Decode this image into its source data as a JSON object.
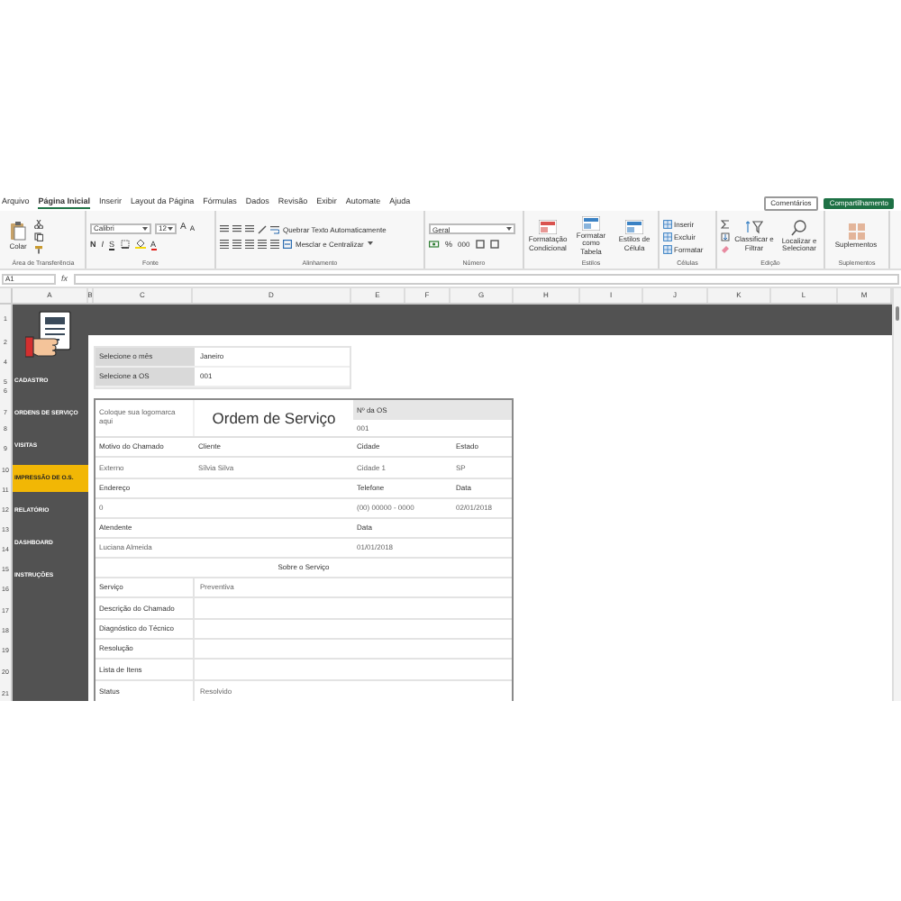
{
  "menu_tabs": [
    {
      "label": "Arquivo",
      "selected": false
    },
    {
      "label": "Página Inicial",
      "selected": true
    },
    {
      "label": "Inserir",
      "selected": false
    },
    {
      "label": "Layout da Página",
      "selected": false
    },
    {
      "label": "Fórmulas",
      "selected": false
    },
    {
      "label": "Dados",
      "selected": false
    },
    {
      "label": "Revisão",
      "selected": false
    },
    {
      "label": "Exibir",
      "selected": false
    },
    {
      "label": "Automate",
      "selected": false
    },
    {
      "label": "Ajuda",
      "selected": false
    }
  ],
  "header_buttons": [
    {
      "label": "Comentários",
      "kind": "outline"
    },
    {
      "label": "Compartilhamento",
      "kind": "primary"
    }
  ],
  "ribbon_groups": [
    {
      "kind": "clipboard",
      "title": "Área de Transferência",
      "paste_label": "Colar"
    },
    {
      "kind": "font",
      "title": "Fonte",
      "font_name": "Calibri",
      "font_size": "12",
      "bold": "N",
      "italic": "I",
      "underline": "S",
      "grow": "A",
      "shrink": "A",
      "font_color": "A"
    },
    {
      "kind": "alignment",
      "title": "Alinhamento",
      "wrap_label": "Quebrar Texto Automaticamente",
      "merge_label": "Mesclar e Centralizar"
    },
    {
      "kind": "number",
      "title": "Número",
      "format": "Geral",
      "percent": "%",
      "thousands": "000"
    },
    {
      "kind": "styles",
      "title": "Estilos",
      "buttons": [
        "Formatação Condicional",
        "Formatar como Tabela",
        "Estilos de Célula"
      ]
    },
    {
      "kind": "cells",
      "title": "Células",
      "buttons": [
        "Inserir",
        "Excluir",
        "Formatar"
      ]
    },
    {
      "kind": "editing",
      "title": "Edição",
      "buttons": [
        "Classificar e Filtrar",
        "Localizar e Selecionar"
      ]
    },
    {
      "kind": "addins",
      "title": "Suplementos",
      "buttons": [
        "Suplementos"
      ]
    }
  ],
  "formula_bar": {
    "cell_ref": "A1",
    "fx": "fx"
  },
  "column_headers": [
    "A",
    "B",
    "C",
    "D",
    "E",
    "F",
    "G",
    "H",
    "I",
    "J",
    "K",
    "L",
    "M"
  ],
  "row_numbers": [
    "1",
    "2",
    "4",
    "5",
    "6",
    "7",
    "8",
    "9",
    "10",
    "11",
    "12",
    "13",
    "14",
    "15",
    "16",
    "17",
    "18",
    "19",
    "20",
    "21"
  ],
  "sidebar": {
    "items": [
      {
        "label": "CADASTRO",
        "selected": false
      },
      {
        "label": "ORDENS DE SERVIÇO",
        "selected": false
      },
      {
        "label": "VISITAS",
        "selected": false
      },
      {
        "label": "IMPRESSÃO DE O.S.",
        "selected": true
      },
      {
        "label": "RELATÓRIO",
        "selected": false
      },
      {
        "label": "DASHBOARD",
        "selected": false
      },
      {
        "label": "INSTRUÇÕES",
        "selected": false
      }
    ]
  },
  "selection": [
    {
      "label": "Selecione o mês",
      "value": "Janeiro"
    },
    {
      "label": "Selecione a OS",
      "value": "001"
    }
  ],
  "form": {
    "logo_placeholder": "Coloque sua logomarca aqui",
    "title": "Ordem de Serviço",
    "os_label": "Nº da OS",
    "os_number": "001",
    "info_rows": [
      {
        "kind": "label",
        "c": "Motivo do Chamado",
        "d": "Cliente",
        "e": "Cidade",
        "g": "Estado"
      },
      {
        "kind": "value",
        "c": "Externo",
        "d": "Sílvia Silva",
        "e": "Cidade 1",
        "g": "SP"
      },
      {
        "kind": "label",
        "c": "Endereço",
        "e": "Telefone",
        "g": "Data"
      },
      {
        "kind": "value",
        "c": "0",
        "e": "(00) 00000 - 0000",
        "g": "02/01/2018"
      },
      {
        "kind": "label",
        "c": "Atendente",
        "e": "Data"
      },
      {
        "kind": "value",
        "c": "Luciana Almeida",
        "e": "01/01/2018"
      }
    ],
    "section_title": "Sobre o Serviço",
    "service_rows": [
      {
        "label": "Serviço",
        "value": "Preventiva"
      },
      {
        "label": "Descrição do Chamado"
      },
      {
        "label": "Diagnóstico do Técnico"
      },
      {
        "label": "Resolução"
      },
      {
        "label": "Lista de Itens"
      },
      {
        "label": "Status",
        "value": "Resolvido"
      }
    ]
  }
}
